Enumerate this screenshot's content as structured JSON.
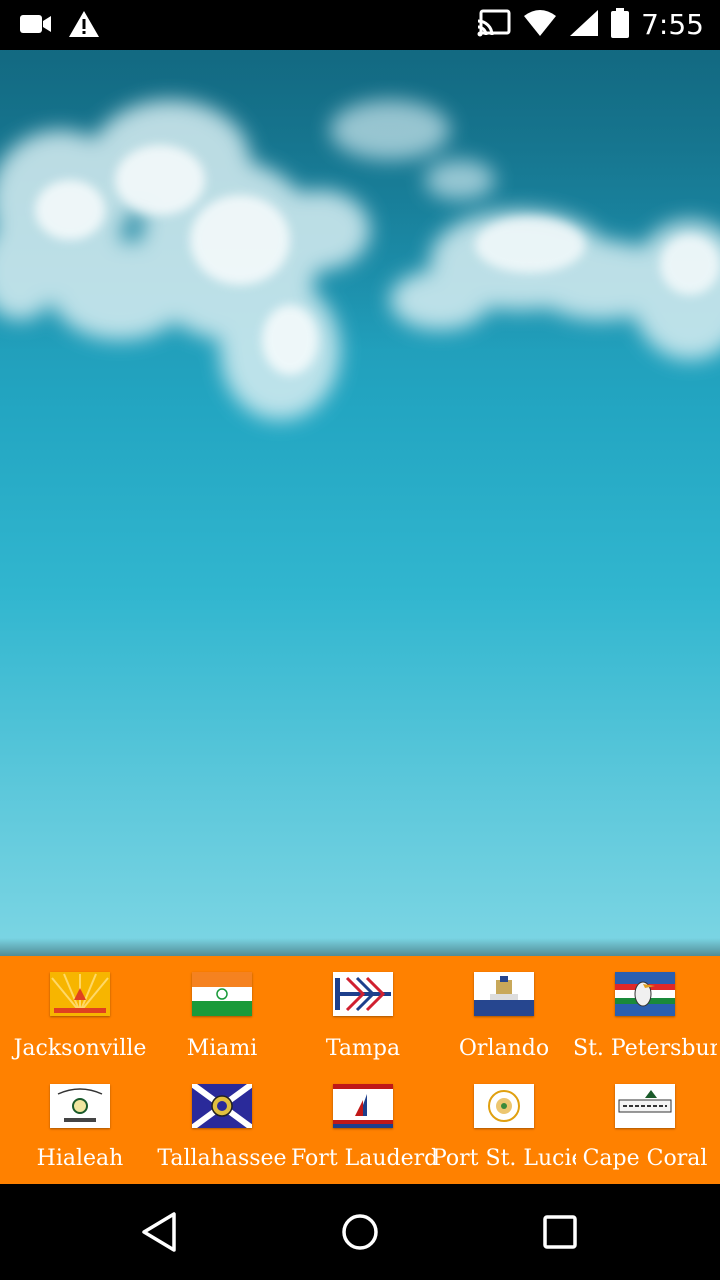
{
  "status_bar": {
    "time": "7:55",
    "icons": [
      "video-camera-icon",
      "warning-icon",
      "cast-icon",
      "wifi-icon",
      "signal-icon",
      "battery-icon"
    ]
  },
  "cities": [
    {
      "name": "Jacksonville",
      "flag_colors": [
        "#f7b500",
        "#e04020"
      ]
    },
    {
      "name": "Miami",
      "flag_colors": [
        "#f58220",
        "#ffffff",
        "#1a9a3a"
      ]
    },
    {
      "name": "Tampa",
      "flag_colors": [
        "#ffffff",
        "#1d3f8c",
        "#d02030"
      ]
    },
    {
      "name": "Orlando",
      "flag_colors": [
        "#ffffff",
        "#26468f"
      ]
    },
    {
      "name": "St. Petersburg",
      "flag_colors": [
        "#2a5fb0",
        "#e02828",
        "#1a8a3a"
      ]
    },
    {
      "name": "Hialeah",
      "flag_colors": [
        "#ffffff",
        "#1a5a2a"
      ]
    },
    {
      "name": "Tallahassee",
      "flag_colors": [
        "#2a2a9a",
        "#ffffff"
      ]
    },
    {
      "name": "Fort Lauderdale",
      "flag_colors": [
        "#ffffff",
        "#c01818",
        "#1d3f8c"
      ]
    },
    {
      "name": "Port St. Lucie",
      "flag_colors": [
        "#ffffff",
        "#e0a010"
      ]
    },
    {
      "name": "Cape Coral",
      "flag_colors": [
        "#ffffff",
        "#1a5a2a"
      ]
    }
  ],
  "nav": {
    "back": "back-icon",
    "home": "home-icon",
    "recents": "recents-icon"
  },
  "colors": {
    "panel": "#ff8100",
    "sky_top": "#1b7f9a",
    "sky_bottom": "#7dd6e4"
  }
}
